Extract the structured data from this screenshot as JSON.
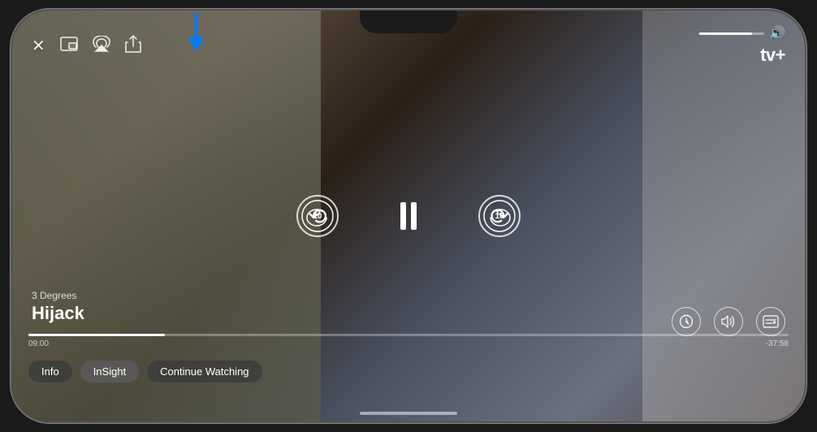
{
  "app": {
    "name": "Apple TV+",
    "logo_text": "tv+",
    "apple_symbol": ""
  },
  "phone": {
    "notch": true
  },
  "video": {
    "show": "3 Degrees",
    "title": "Hijack",
    "episode_label": "3 Degrees",
    "current_time": "09:00",
    "remaining_time": "-37:58",
    "progress_percent": 18
  },
  "controls": {
    "close_label": "✕",
    "picture_in_picture_label": "⧉",
    "airplay_label": "⊡",
    "share_label": "⬆",
    "rewind_seconds": "10",
    "forward_seconds": "10",
    "pause_label": "pause",
    "volume_icon": "🔊",
    "speed_icon": "⊙",
    "audio_icon": "≋",
    "subtitles_icon": "☰"
  },
  "bottom_buttons": [
    {
      "id": "info",
      "label": "Info"
    },
    {
      "id": "insight",
      "label": "InSight"
    },
    {
      "id": "continue_watching",
      "label": "Continue Watching"
    }
  ],
  "arrow": {
    "color": "#007AFF",
    "direction": "down",
    "label": "pointing to airplay button"
  }
}
